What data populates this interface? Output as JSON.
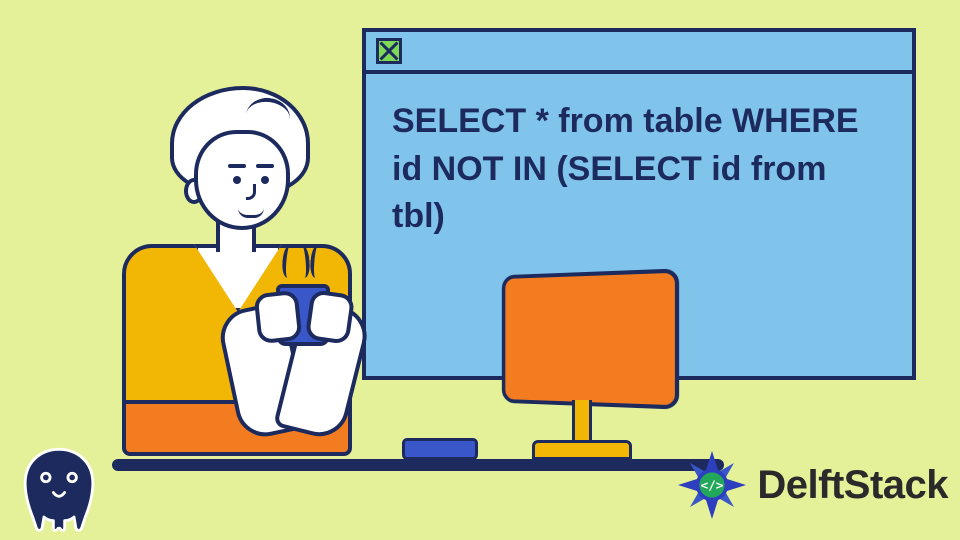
{
  "sql_window": {
    "query": "SELECT * from table WHERE id NOT IN (SELECT id from tbl)"
  },
  "brand": {
    "name": "DelftStack"
  },
  "colors": {
    "bg": "#e5f199",
    "window_bg": "#80c4ec",
    "stroke": "#1c2a5e",
    "orange": "#f47c20",
    "yellow": "#f2b705",
    "blue": "#3a57c9"
  },
  "icons": {
    "close": "close-icon",
    "elephant": "postgresql-elephant-icon",
    "delft_mark": "delftstack-mark-icon"
  }
}
